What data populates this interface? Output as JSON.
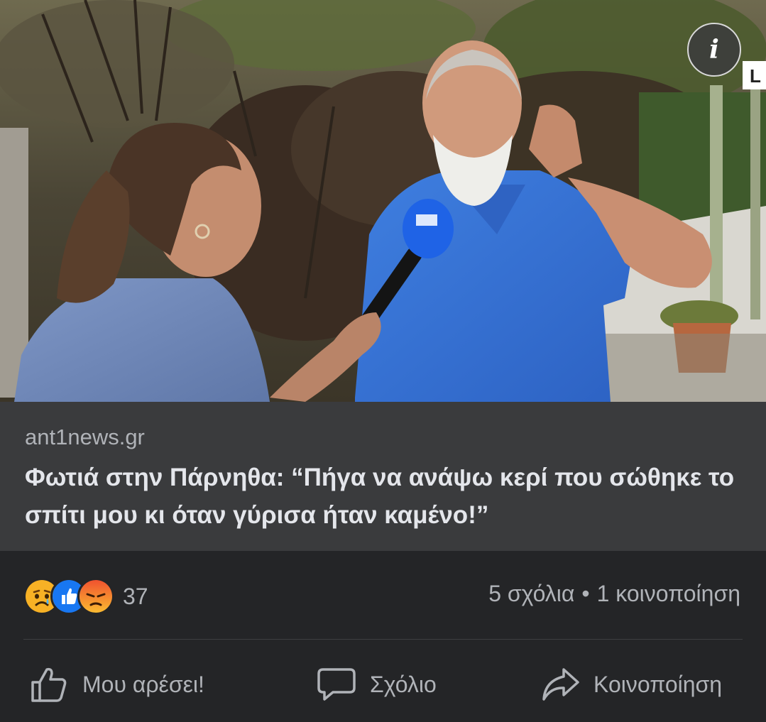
{
  "photo": {
    "description_icon": "info-icon",
    "info_glyph": "i",
    "corner_letter": "L"
  },
  "link": {
    "domain": "ant1news.gr",
    "headline": "Φωτιά στην Πάρνηθα: “Πήγα να ανάψω κερί που σώθηκε το σπίτι μου κι όταν γύρισα ήταν καμένο!”"
  },
  "stats": {
    "reactions": [
      "sad-reaction-icon",
      "like-reaction-icon",
      "angry-reaction-icon"
    ],
    "reaction_count": "37",
    "comments": "5 σχόλια",
    "separator": "•",
    "shares": "1 κοινοποίηση"
  },
  "actions": {
    "like": "Μου αρέσει!",
    "comment": "Σχόλιο",
    "share": "Κοινοποίηση"
  },
  "colors": {
    "background": "#242527",
    "link_background": "#3a3b3d",
    "headline": "#e4e6eb",
    "secondary_text": "#b0b3b8",
    "like_blue": "#1877f2",
    "angry_red": "#f0522f",
    "sad_yellow": "#f7b125"
  }
}
